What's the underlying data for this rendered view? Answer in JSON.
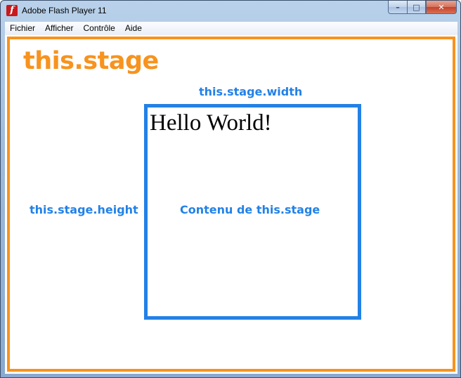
{
  "window": {
    "title": "Adobe Flash Player 11",
    "icon": "flash-player-icon",
    "icon_glyph": "f",
    "buttons": {
      "minimize_glyph": "–",
      "maximize_glyph": "□",
      "close_glyph": "✕"
    }
  },
  "menubar": {
    "items": [
      "Fichier",
      "Afficher",
      "Contrôle",
      "Aide"
    ]
  },
  "stage": {
    "title": "this.stage",
    "width_label": "this.stage.width",
    "height_label": "this.stage.height",
    "content_label": "Contenu de this.stage",
    "hello_text": "Hello World!"
  },
  "colors": {
    "stage_orange": "#f7931e",
    "annotation_blue": "#2381e6",
    "flash_red": "#c8191d"
  }
}
